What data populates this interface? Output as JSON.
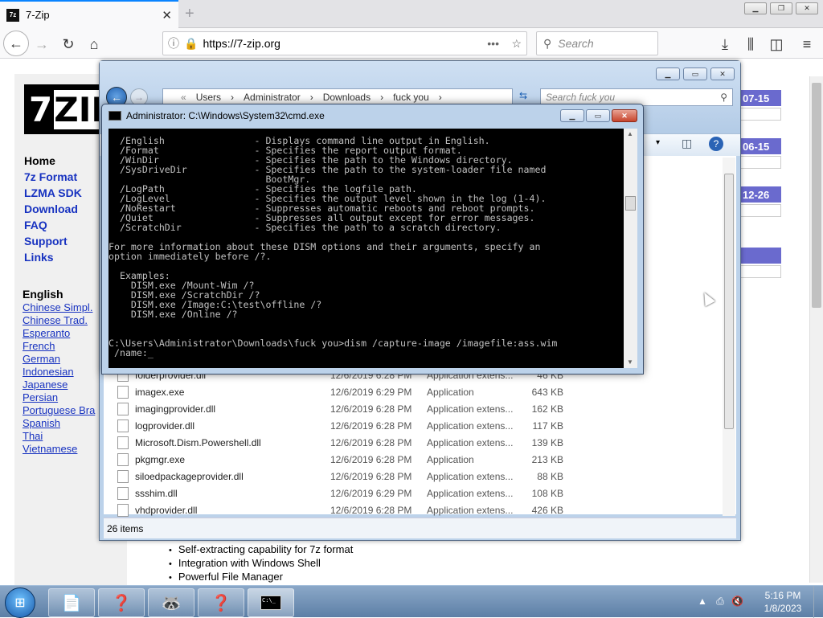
{
  "browser": {
    "tab_title": "7-Zip",
    "tab_favicon": "7z",
    "url": "https://7-zip.org",
    "search_placeholder": "Search",
    "icons": [
      "back-arrow-icon",
      "forward-arrow-icon",
      "reload-icon",
      "home-icon",
      "info-icon",
      "lock-icon",
      "page-actions-icon",
      "bookmark-star-icon",
      "search-icon",
      "download-icon",
      "library-icon",
      "sidebar-icon",
      "menu-icon"
    ]
  },
  "website": {
    "logo_text": "7",
    "logo_text2": "ZIP",
    "nav": [
      "Home",
      "7z Format",
      "LZMA SDK",
      "Download",
      "FAQ",
      "Support",
      "Links"
    ],
    "current_lang": "English",
    "languages": [
      "Chinese Simpl.",
      "Chinese Trad.",
      "Esperanto",
      "French",
      "German",
      "Indonesian",
      "Japanese",
      "Persian",
      "Portuguese Bra",
      "Spanish",
      "Thai",
      "Vietnamese"
    ],
    "features": [
      "Self-extracting capability for 7z format",
      "Integration with Windows Shell",
      "Powerful File Manager"
    ],
    "dates": [
      "07-15",
      "06-15",
      "12-26"
    ]
  },
  "explorer": {
    "breadcrumb": [
      "Users",
      "Administrator",
      "Downloads",
      "fuck you"
    ],
    "search_placeholder": "Search fuck you",
    "files": [
      {
        "name": "folderprovider.dll",
        "date": "12/6/2019 6:28 PM",
        "type": "Application extens...",
        "size": "46 KB"
      },
      {
        "name": "imagex.exe",
        "date": "12/6/2019 6:29 PM",
        "type": "Application",
        "size": "643 KB"
      },
      {
        "name": "imagingprovider.dll",
        "date": "12/6/2019 6:28 PM",
        "type": "Application extens...",
        "size": "162 KB"
      },
      {
        "name": "logprovider.dll",
        "date": "12/6/2019 6:28 PM",
        "type": "Application extens...",
        "size": "117 KB"
      },
      {
        "name": "Microsoft.Dism.Powershell.dll",
        "date": "12/6/2019 6:28 PM",
        "type": "Application extens...",
        "size": "139 KB"
      },
      {
        "name": "pkgmgr.exe",
        "date": "12/6/2019 6:28 PM",
        "type": "Application",
        "size": "213 KB"
      },
      {
        "name": "siloedpackageprovider.dll",
        "date": "12/6/2019 6:28 PM",
        "type": "Application extens...",
        "size": "88 KB"
      },
      {
        "name": "ssshim.dll",
        "date": "12/6/2019 6:29 PM",
        "type": "Application extens...",
        "size": "108 KB"
      },
      {
        "name": "vhdprovider.dll",
        "date": "12/6/2019 6:28 PM",
        "type": "Application extens...",
        "size": "426 KB"
      }
    ],
    "status": "26 items"
  },
  "cmd": {
    "title": "Administrator: C:\\Windows\\System32\\cmd.exe",
    "lines": [
      "  /English                - Displays command line output in English.",
      "  /Format                 - Specifies the report output format.",
      "  /WinDir                 - Specifies the path to the Windows directory.",
      "  /SysDriveDir            - Specifies the path to the system-loader file named",
      "                            BootMgr.",
      "  /LogPath                - Specifies the logfile path.",
      "  /LogLevel               - Specifies the output level shown in the log (1-4).",
      "  /NoRestart              - Suppresses automatic reboots and reboot prompts.",
      "  /Quiet                  - Suppresses all output except for error messages.",
      "  /ScratchDir             - Specifies the path to a scratch directory.",
      "",
      "For more information about these DISM options and their arguments, specify an",
      "option immediately before /?.",
      "",
      "  Examples:",
      "    DISM.exe /Mount-Wim /?",
      "    DISM.exe /ScratchDir /?",
      "    DISM.exe /Image:C:\\test\\offline /?",
      "    DISM.exe /Online /?",
      "",
      "",
      "C:\\Users\\Administrator\\Downloads\\fuck you>dism /capture-image /imagefile:ass.wim",
      " /name:_"
    ]
  },
  "taskbar": {
    "time": "5:16 PM",
    "date": "1/8/2023"
  }
}
